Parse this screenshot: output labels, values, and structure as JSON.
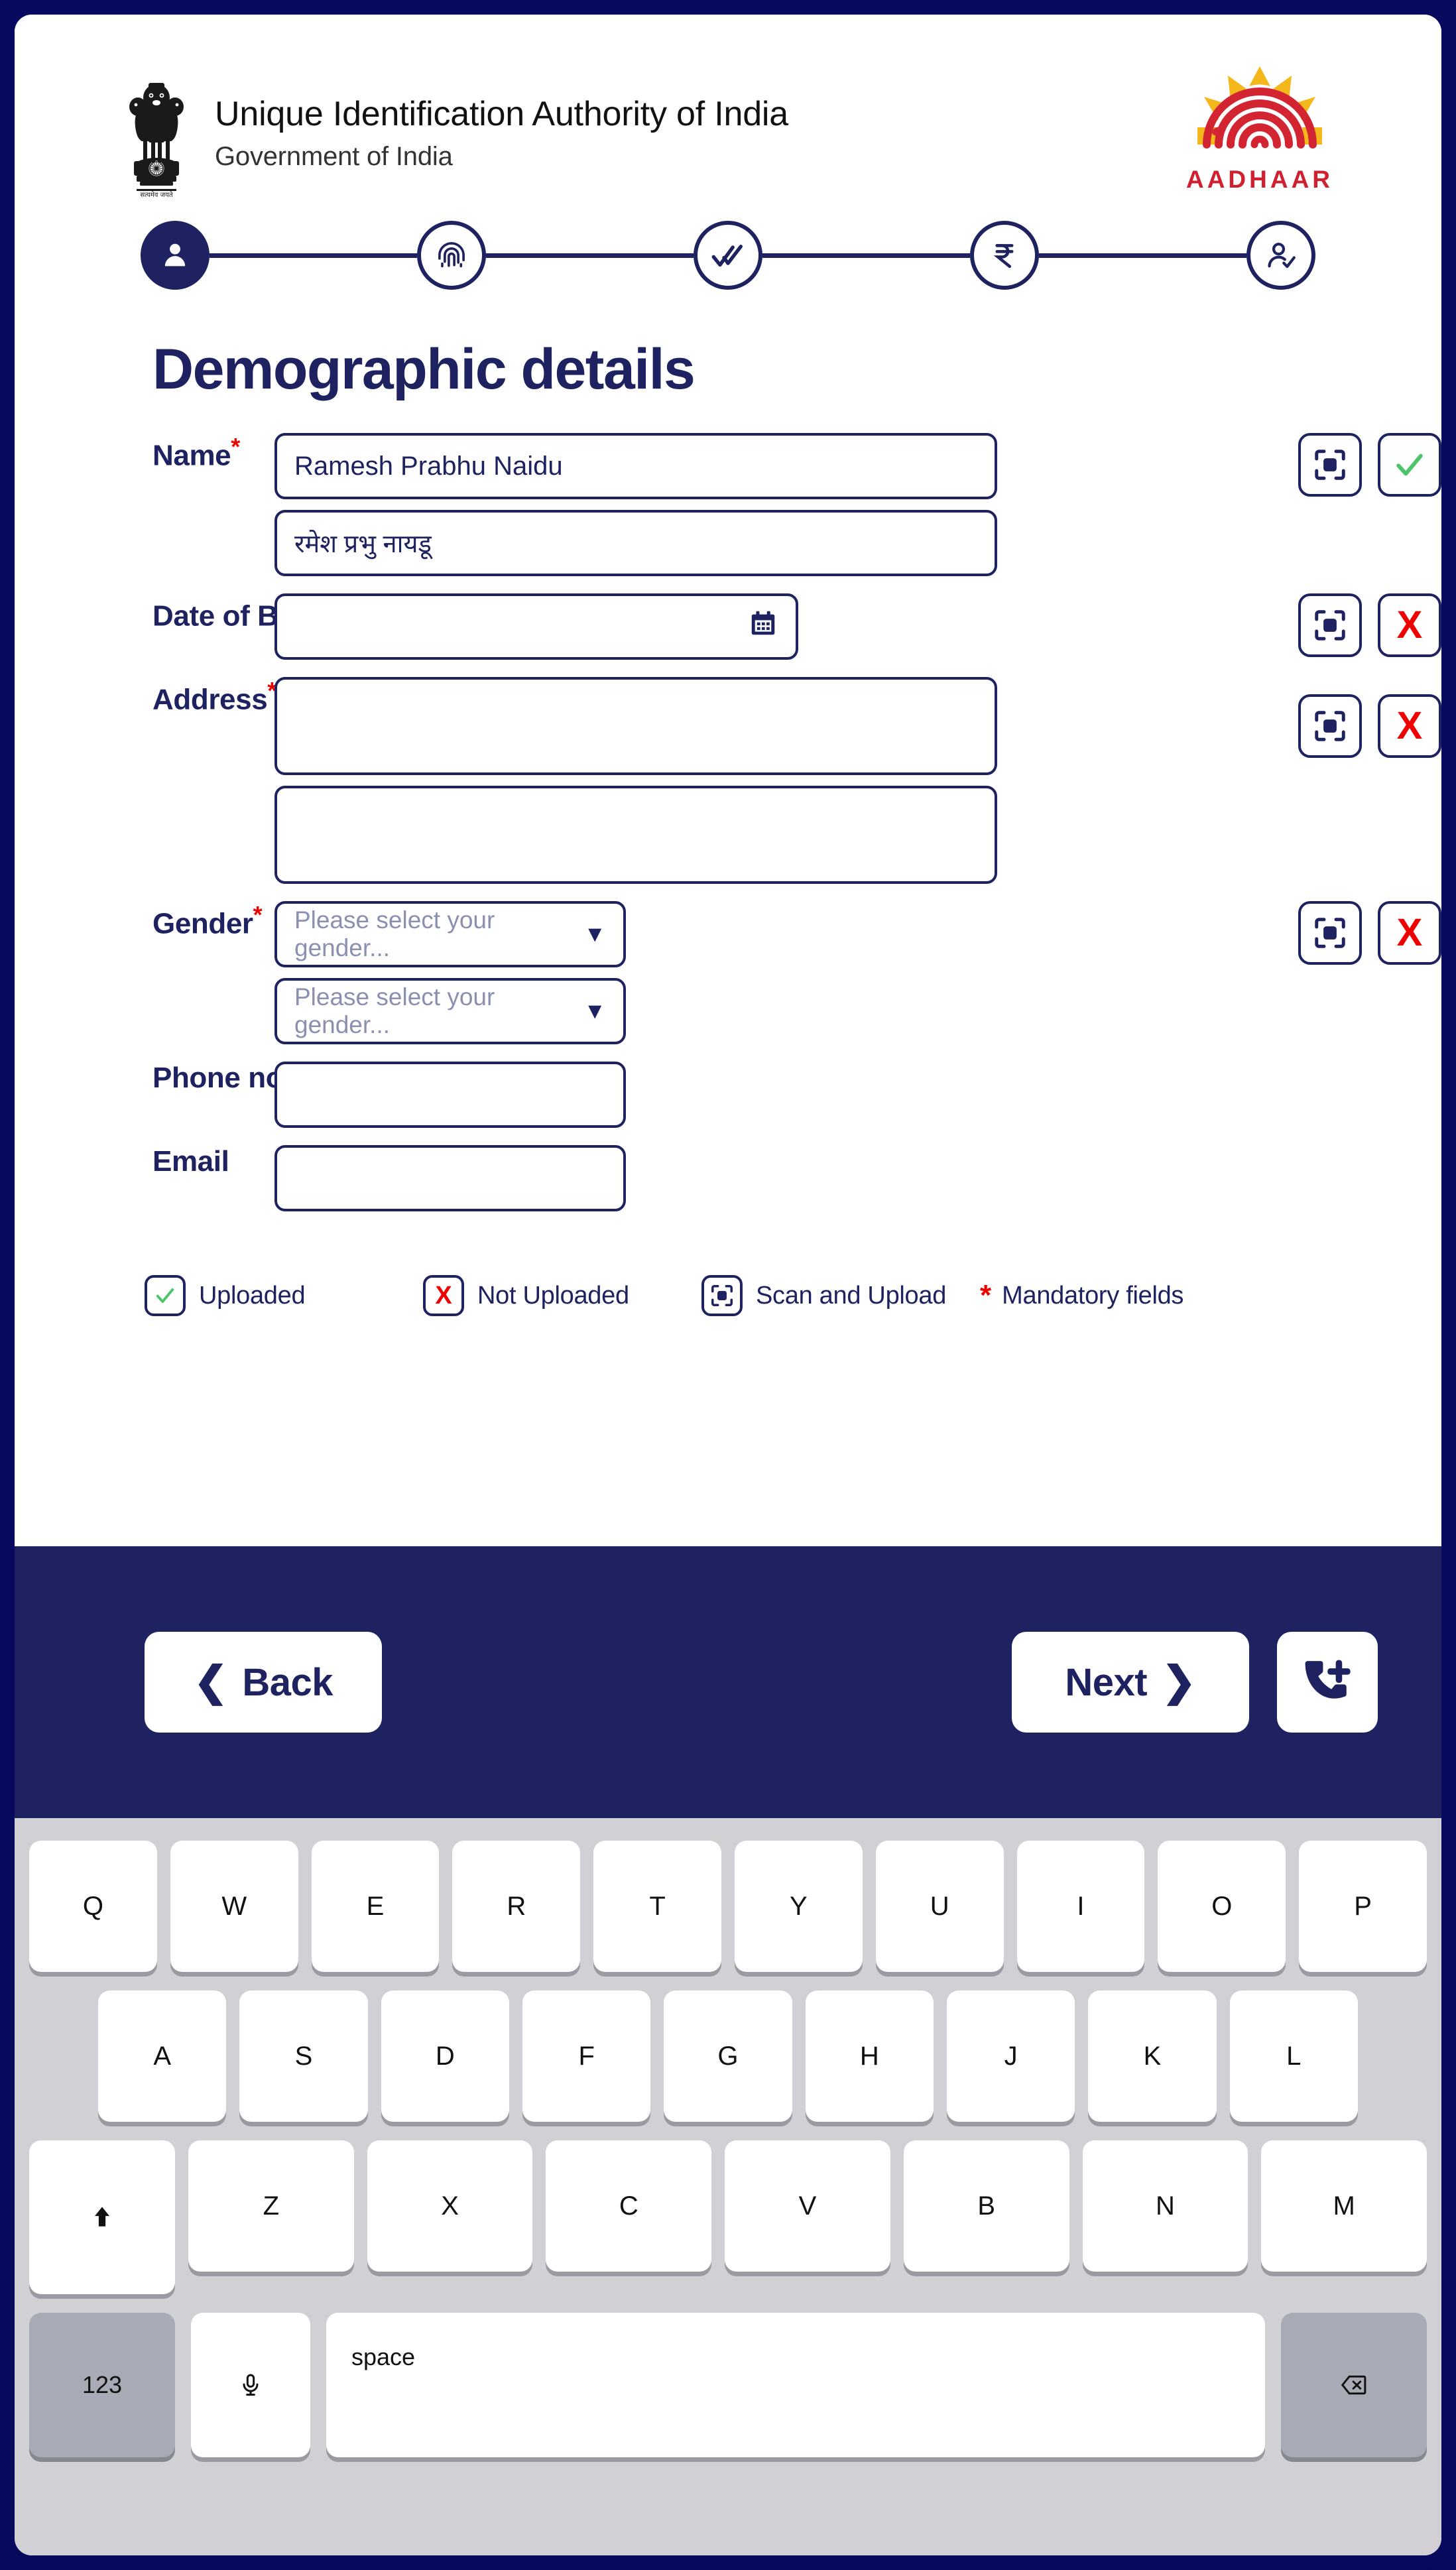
{
  "header": {
    "emblem_icon": "ashoka-emblem",
    "org_title": "Unique Identification Authority of India",
    "org_subtitle": "Government of India",
    "logo_word": "AADHAAR",
    "logo_icon": "aadhaar-fingerprint-logo"
  },
  "stepper": {
    "steps": [
      {
        "icon": "person-icon",
        "active": true
      },
      {
        "icon": "fingerprint-icon",
        "active": false
      },
      {
        "icon": "double-check-icon",
        "active": false
      },
      {
        "icon": "rupee-icon",
        "active": false
      },
      {
        "icon": "person-verified-icon",
        "active": false
      }
    ]
  },
  "page": {
    "title": "Demographic details"
  },
  "form": {
    "name": {
      "label": "Name",
      "required": true,
      "value_latin": "Ramesh Prabhu Naidu",
      "value_devanagari": "रमेश प्रभु नायडू",
      "scan_icon": "scan-and-upload-icon",
      "status_icon": "check-icon",
      "status": "uploaded"
    },
    "dob": {
      "label": "Date of Birth",
      "required": true,
      "value": "",
      "calendar_icon": "calendar-icon",
      "scan_icon": "scan-and-upload-icon",
      "status_icon": "x-icon",
      "status": "not-uploaded"
    },
    "address": {
      "label": "Address",
      "required": true,
      "value_line1": "",
      "value_line2": "",
      "scan_icon": "scan-and-upload-icon",
      "status_icon": "x-icon",
      "status": "not-uploaded"
    },
    "gender": {
      "label": "Gender",
      "required": true,
      "placeholder": "Please select your gender...",
      "placeholder_secondary": "Please select your gender...",
      "value": "",
      "dropdown_icon": "chevron-down-icon",
      "scan_icon": "scan-and-upload-icon",
      "status_icon": "x-icon",
      "status": "not-uploaded"
    },
    "phone": {
      "label": "Phone no.",
      "required": false,
      "value": ""
    },
    "email": {
      "label": "Email",
      "required": false,
      "value": ""
    }
  },
  "legend": [
    {
      "icon": "check-icon",
      "label": "Uploaded"
    },
    {
      "icon": "x-icon",
      "label": "Not Uploaded"
    },
    {
      "icon": "scan-and-upload-icon",
      "label": "Scan and Upload"
    },
    {
      "icon": "asterisk-icon",
      "label": "Mandatory fields"
    }
  ],
  "nav": {
    "back_label": "Back",
    "back_icon": "chevron-left-icon",
    "next_label": "Next",
    "next_icon": "chevron-right-icon",
    "phone_icon": "phone-add-icon"
  },
  "keyboard": {
    "row1": [
      "Q",
      "W",
      "E",
      "R",
      "T",
      "Y",
      "U",
      "I",
      "O",
      "P"
    ],
    "row2": [
      "A",
      "S",
      "D",
      "F",
      "G",
      "H",
      "J",
      "K",
      "L"
    ],
    "row3_shift": "shift-up-icon",
    "row3": [
      "Z",
      "X",
      "C",
      "V",
      "B",
      "N",
      "M"
    ],
    "numbers_label": "123",
    "mic_icon": "microphone-icon",
    "space_label": "space",
    "backspace_icon": "backspace-icon"
  },
  "colors": {
    "navy": "#1e2260",
    "outer_border": "#06095e",
    "red": "#ee0000",
    "green": "#4cc56a",
    "aadhaar_red": "#cf2030",
    "aadhaar_yellow": "#f5b81c",
    "keyboard_bg": "#d0d0d5",
    "key_gray": "#a8abb5"
  }
}
